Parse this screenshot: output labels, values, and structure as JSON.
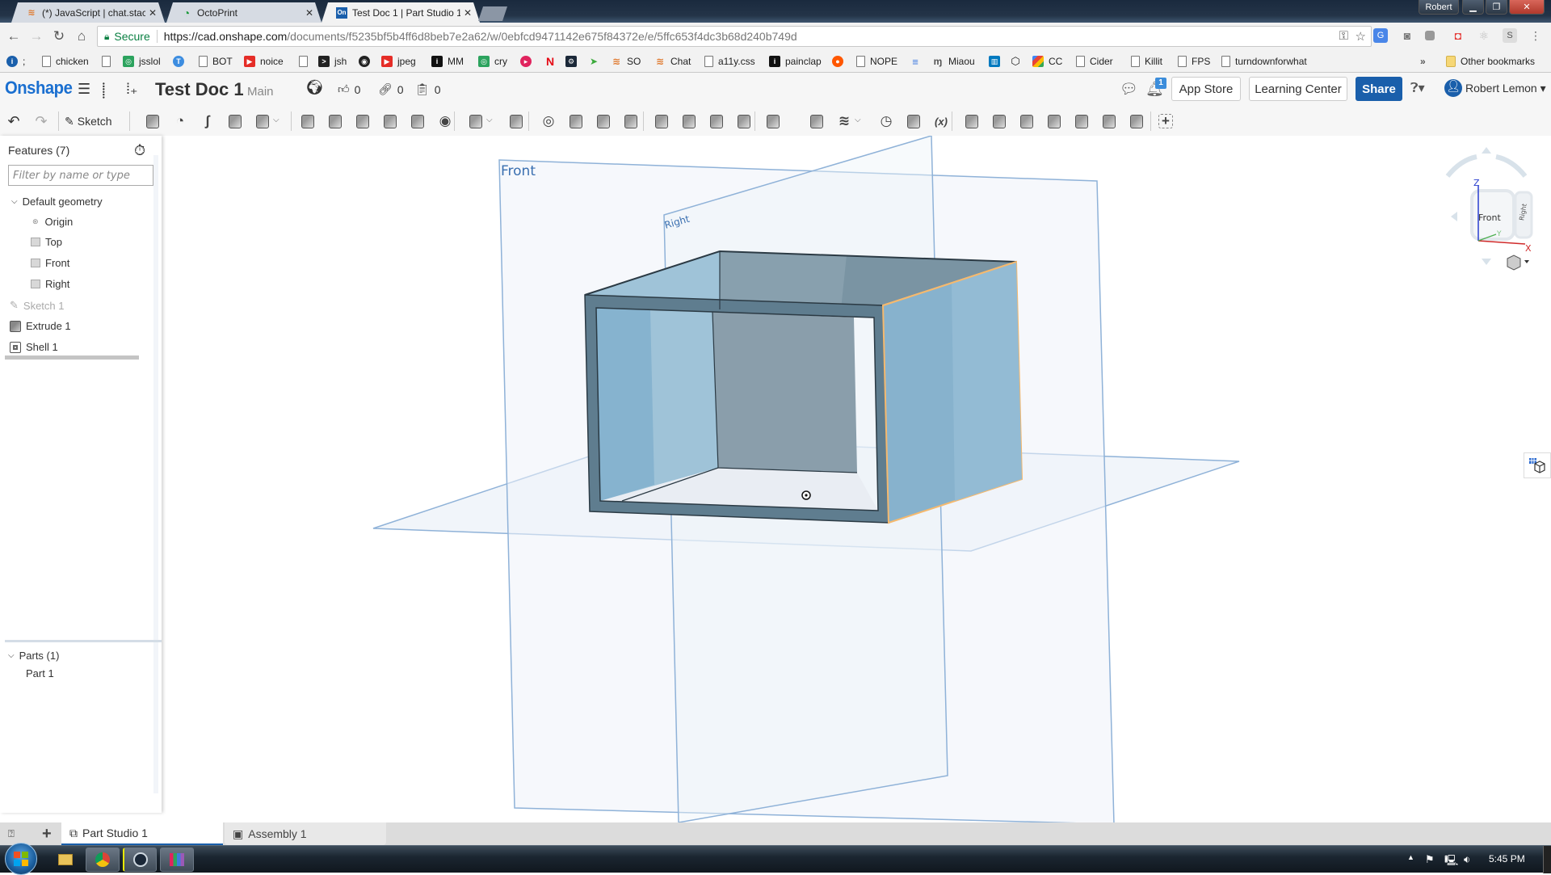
{
  "browser": {
    "tabs": [
      {
        "title": "(*) JavaScript | chat.stackexchange",
        "favicon": "stackoverflow-icon",
        "active": false
      },
      {
        "title": "OctoPrint",
        "favicon": "octoprint-icon",
        "active": false
      },
      {
        "title": "Test Doc 1 | Part Studio 1",
        "favicon": "onshape-icon",
        "active": true
      }
    ],
    "window_user": "Robert",
    "secure_label": "Secure",
    "url_scheme_host": "https://cad.onshape.com",
    "url_path": "/documents/f5235bf5b4ff6d8beb7e2a62/w/0ebfcd9471142e675f84372e/e/5ffc653f4dc3b68d240b749d",
    "bookmarks": [
      {
        "label": ";",
        "icon": "info-icon"
      },
      {
        "label": "chicken",
        "icon": "page-icon"
      },
      {
        "label": "jsslol",
        "icon": "jsfiddle-icon"
      },
      {
        "label": "",
        "icon": "t-circle-icon"
      },
      {
        "label": "BOT",
        "icon": "page-icon"
      },
      {
        "label": "noice",
        "icon": "youtube-icon"
      },
      {
        "label": "",
        "icon": "page-icon"
      },
      {
        "label": "jsh",
        "icon": "terminal-icon"
      },
      {
        "label": "",
        "icon": "github-icon"
      },
      {
        "label": "jpeg",
        "icon": "youtube-icon"
      },
      {
        "label": "MM",
        "icon": "info-dark-icon"
      },
      {
        "label": "cry",
        "icon": "jsfiddle-icon"
      },
      {
        "label": "",
        "icon": "play-circle-icon"
      },
      {
        "label": "",
        "icon": "netflix-icon"
      },
      {
        "label": "",
        "icon": "steam-icon"
      },
      {
        "label": "",
        "icon": "paper-plane-icon"
      },
      {
        "label": "SO",
        "icon": "stackoverflow-icon"
      },
      {
        "label": "Chat",
        "icon": "stackoverflow-icon"
      },
      {
        "label": "a11y.css",
        "icon": "page-icon"
      },
      {
        "label": "painclap",
        "icon": "info-dark-icon"
      },
      {
        "label": "",
        "icon": "reddit-icon"
      },
      {
        "label": "NOPE",
        "icon": "page-icon"
      },
      {
        "label": "",
        "icon": "stack-icon"
      },
      {
        "label": "Miaou",
        "icon": "miaou-icon"
      },
      {
        "label": "",
        "icon": "trello-icon"
      },
      {
        "label": "",
        "icon": "codepen-icon"
      },
      {
        "label": "CC",
        "icon": "google-icon"
      },
      {
        "label": "Cider",
        "icon": "page-icon"
      },
      {
        "label": "Killit",
        "icon": "page-icon"
      },
      {
        "label": "FPS",
        "icon": "page-icon"
      },
      {
        "label": "turndownforwhat",
        "icon": "page-icon"
      }
    ],
    "overflow_label": "»",
    "other_bookmarks": "Other bookmarks"
  },
  "onshape": {
    "logo": "Onshape",
    "doc_title": "Test Doc 1",
    "branch": "Main",
    "likes": "0",
    "links": "0",
    "copies": "0",
    "notification_count": "1",
    "app_store": "App Store",
    "learning_center": "Learning Center",
    "share": "Share",
    "user_name": "Robert Lemon",
    "sketch_label": "Sketch"
  },
  "features": {
    "title": "Features (7)",
    "filter_placeholder": "Filter by name or type",
    "default_geometry": "Default geometry",
    "origin": "Origin",
    "planes": [
      "Top",
      "Front",
      "Right"
    ],
    "items": [
      {
        "label": "Sketch 1",
        "icon": "sketch-icon",
        "dimmed": true
      },
      {
        "label": "Extrude 1",
        "icon": "extrude-icon",
        "dimmed": false
      },
      {
        "label": "Shell 1",
        "icon": "shell-icon",
        "dimmed": false
      }
    ],
    "parts_title": "Parts (1)",
    "parts": [
      "Part 1"
    ]
  },
  "viewport": {
    "plane_labels": {
      "front": "Front",
      "right": "Right"
    },
    "viewcube": {
      "front": "Front",
      "right": "Right",
      "axes": [
        "X",
        "Y",
        "Z"
      ]
    },
    "colors": {
      "plane_edge": "#7fa6d1",
      "plane_fill": "#eef3f9",
      "part_face": "#87b2cd",
      "part_inner": "#8a9eab",
      "selection": "#f5b96e"
    }
  },
  "bottom_tabs": [
    {
      "label": "Part Studio 1",
      "active": true
    },
    {
      "label": "Assembly 1",
      "active": false
    }
  ],
  "taskbar": {
    "clock": "5:45 PM"
  }
}
